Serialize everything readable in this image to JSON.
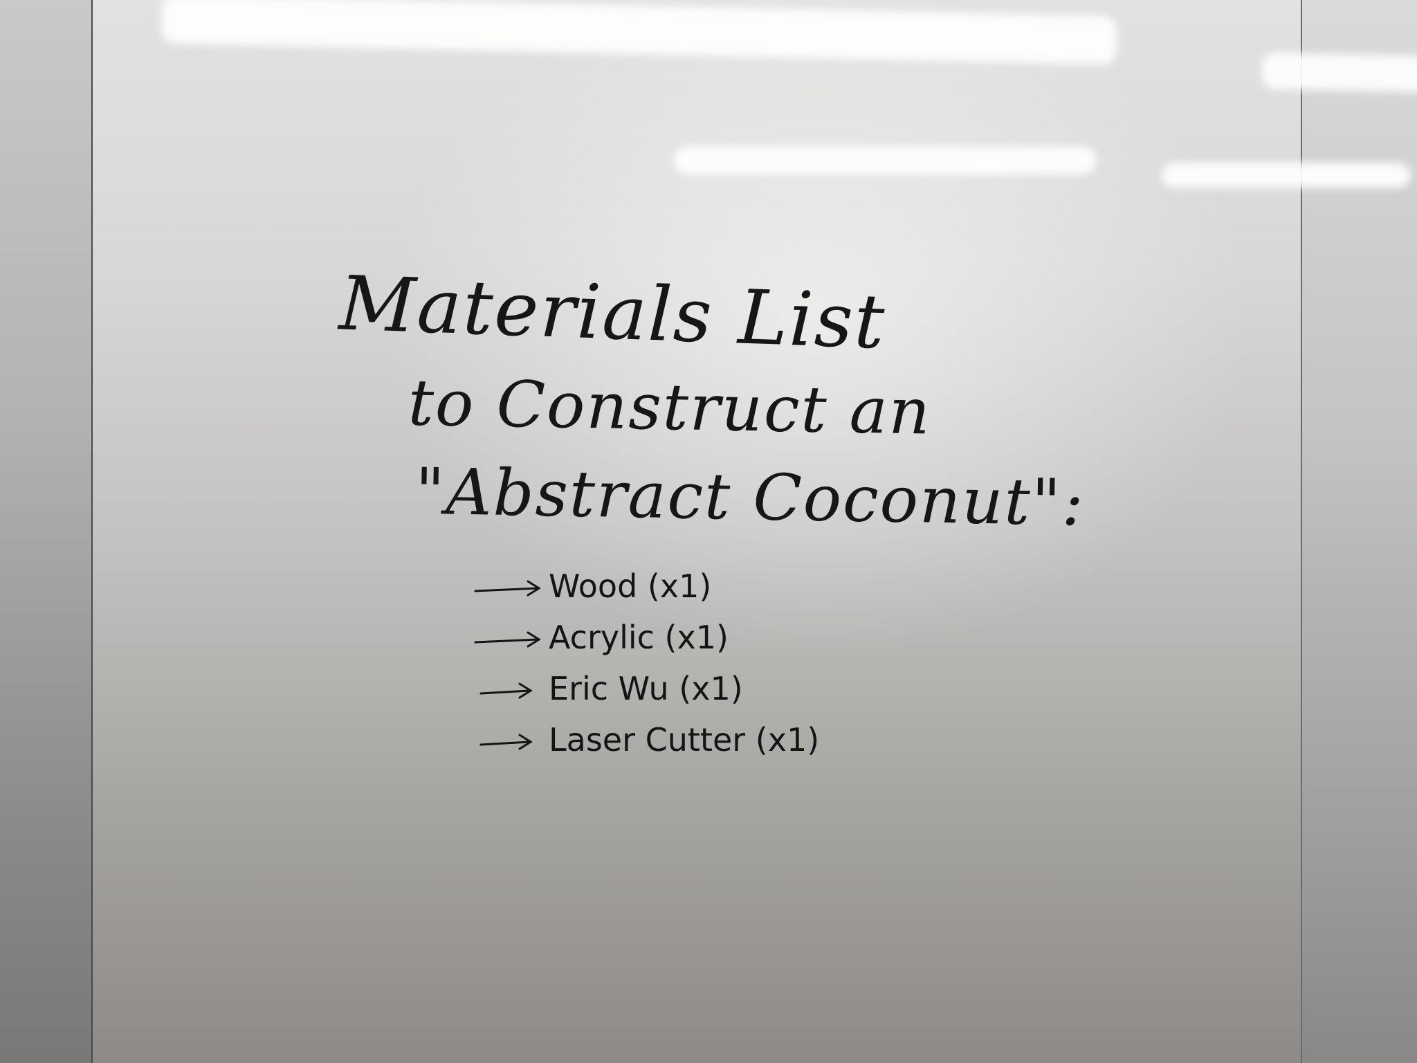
{
  "whiteboard": {
    "title_lines": [
      "Materials List",
      "to Construct an",
      "\"Abstract Coconut\":"
    ],
    "materials": [
      {
        "label": "Wood (x1)"
      },
      {
        "label": "Acrylic (x1)"
      },
      {
        "label": "Eric Wu (x1)"
      },
      {
        "label": "Laser Cutter (x1)"
      }
    ],
    "ink_color": "#161616"
  }
}
